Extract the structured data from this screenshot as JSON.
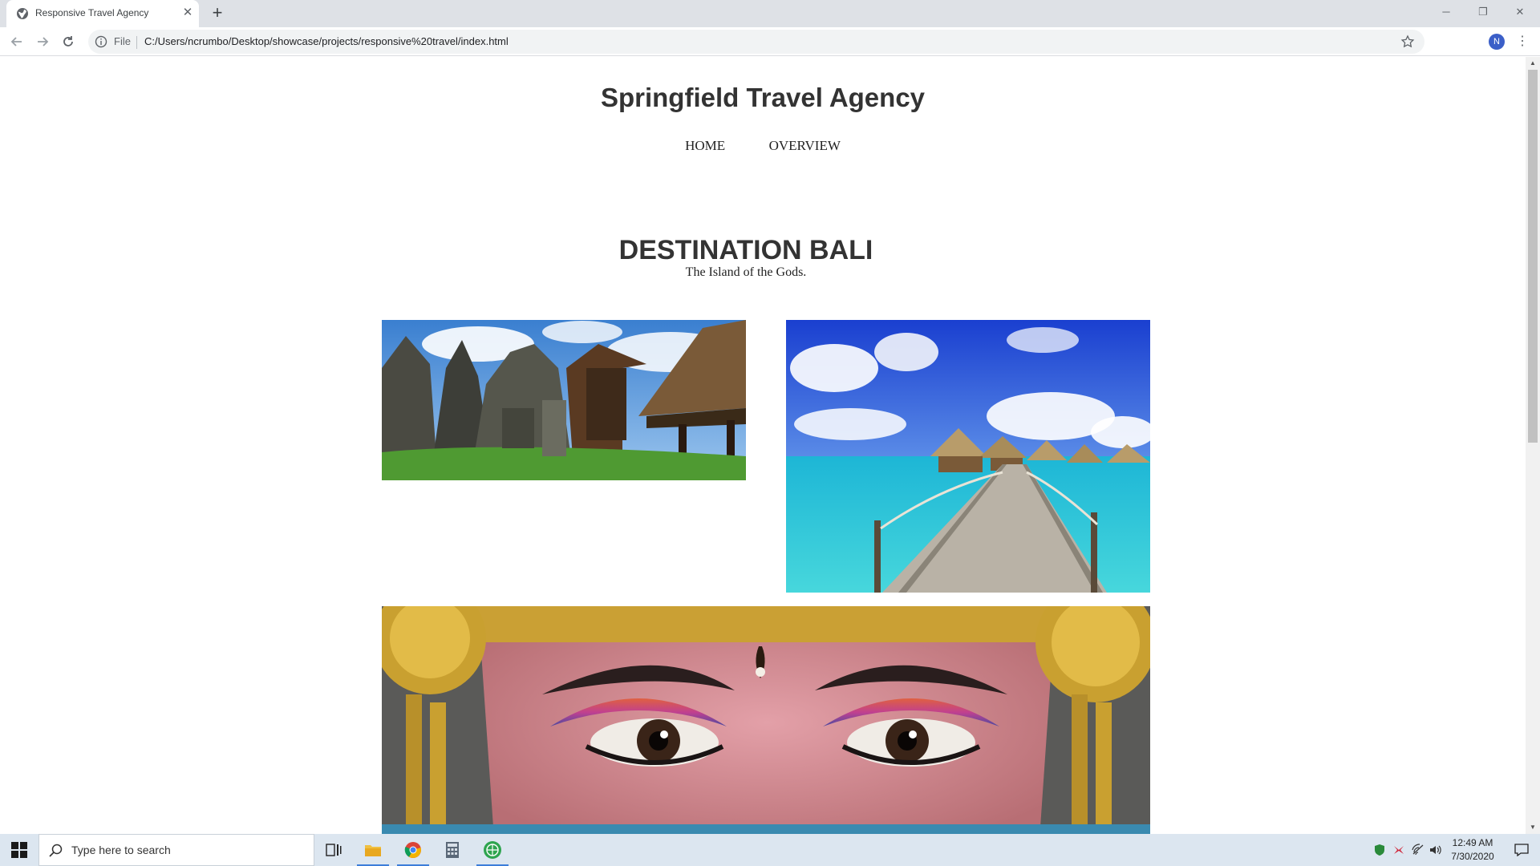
{
  "browser": {
    "tab_title": "Responsive Travel Agency",
    "tab_close": "✕",
    "new_tab": "+",
    "file_label": "File",
    "url": "C:/Users/ncrumbo/Desktop/showcase/projects/responsive%20travel/index.html",
    "profile_initial": "N",
    "window_controls": {
      "minimize": "─",
      "restore": "❐",
      "close": "✕"
    }
  },
  "page": {
    "site_title": "Springfield Travel Agency",
    "nav": [
      "HOME",
      "OVERVIEW"
    ],
    "section_title": "DESTINATION BALI",
    "section_subtitle": "The Island of the Gods."
  },
  "taskbar": {
    "search_placeholder": "Type here to search",
    "time": "12:49 AM",
    "date": "7/30/2020"
  },
  "colors": {
    "tabstrip": "#dee1e6",
    "taskbar": "#dce6f0",
    "heading": "#333333",
    "accent": "#3c7dd9"
  }
}
